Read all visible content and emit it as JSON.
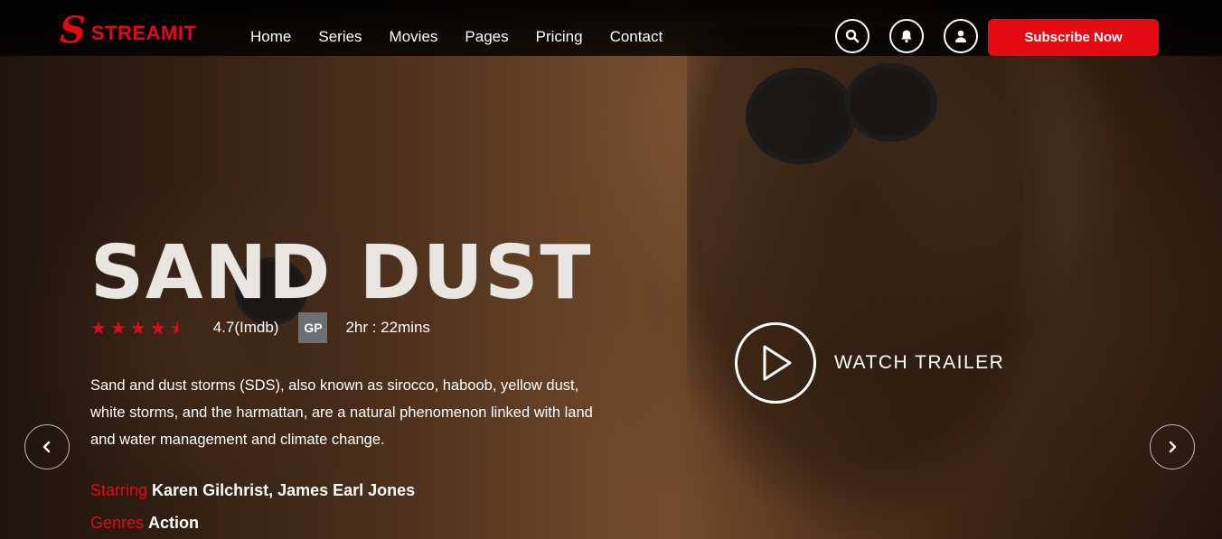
{
  "brand": {
    "logo_mark": "S",
    "name": "STREAMIT",
    "accent_color": "#e50914"
  },
  "nav": {
    "links": [
      "Home",
      "Series",
      "Movies",
      "Pages",
      "Pricing",
      "Contact"
    ],
    "icons": [
      "search-icon",
      "bell-icon",
      "user-icon"
    ],
    "subscribe_label": "Subscribe Now"
  },
  "hero": {
    "title": "SAND DUST",
    "rating_stars": 4.5,
    "rating_text": "4.7(Imdb)",
    "badge": "GP",
    "duration": "2hr : 22mins",
    "description": "Sand and dust storms (SDS), also known as sirocco, haboob, yellow dust, white storms, and the harmattan, are a natural phenomenon linked with land and water management and climate change.",
    "starring_label": "Starring",
    "starring_value": "Karen Gilchrist, James Earl Jones",
    "genres_label": "Genres",
    "genres_value": "Action",
    "trailer_label": "WATCH TRAILER"
  },
  "slider": {
    "prev_icon": "chevron-left-icon",
    "next_icon": "chevron-right-icon"
  }
}
